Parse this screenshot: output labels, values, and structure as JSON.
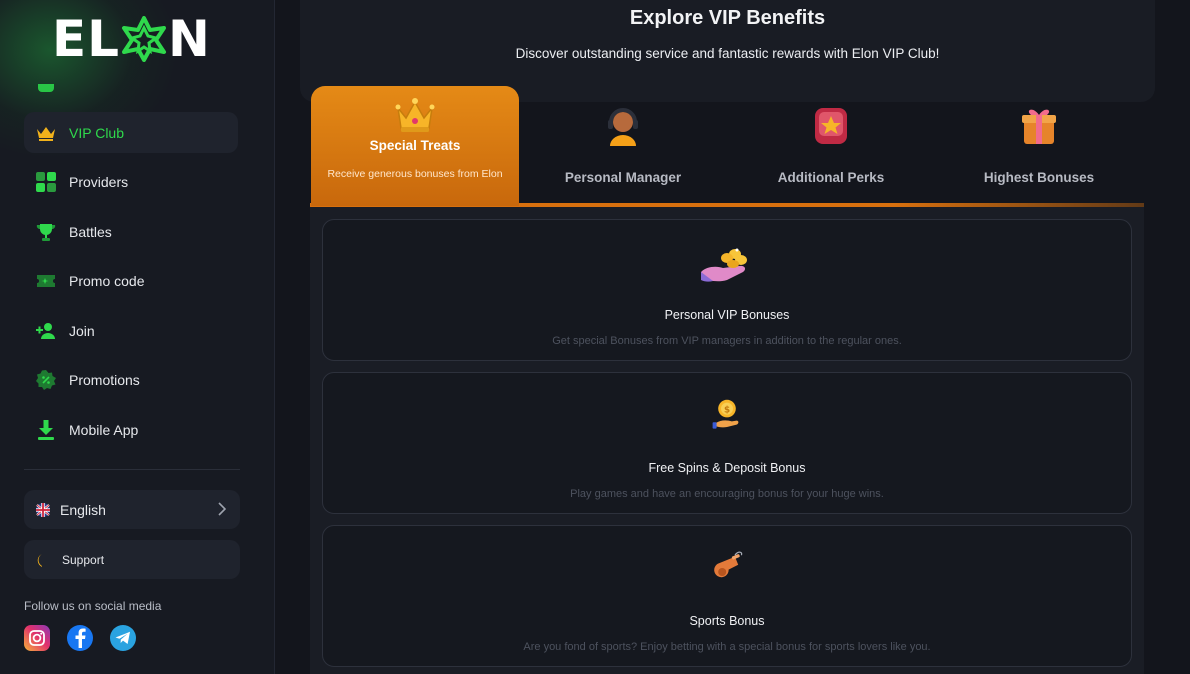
{
  "sidebar": {
    "logo": "ELON",
    "nav": [
      {
        "label": "VIP Club",
        "icon": "crown-icon",
        "active": true
      },
      {
        "label": "Providers",
        "icon": "grid-icon",
        "active": false
      },
      {
        "label": "Battles",
        "icon": "trophy-icon",
        "active": false
      },
      {
        "label": "Promo code",
        "icon": "ticket-icon",
        "active": false
      },
      {
        "label": "Join",
        "icon": "add-user-icon",
        "active": false
      },
      {
        "label": "Promotions",
        "icon": "badge-percent-icon",
        "active": false
      },
      {
        "label": "Mobile App",
        "icon": "download-icon",
        "active": false
      }
    ],
    "language": "English",
    "support": "Support",
    "follow": "Follow us on social media",
    "socials": [
      "instagram-icon",
      "facebook-icon",
      "telegram-icon"
    ]
  },
  "hero": {
    "title": "Explore VIP Benefits",
    "subtitle": "Discover outstanding service and fantastic rewards with Elon VIP Club!"
  },
  "tabs": [
    {
      "title": "Special Treats",
      "desc": "Receive generous bonuses from Elon",
      "icon": "crown-icon",
      "active": true
    },
    {
      "title": "Personal Manager",
      "desc": "",
      "icon": "headset-icon",
      "active": false
    },
    {
      "title": "Additional Perks",
      "desc": "",
      "icon": "star-badge-icon",
      "active": false
    },
    {
      "title": "Highest Bonuses",
      "desc": "",
      "icon": "gift-icon",
      "active": false
    }
  ],
  "cards": [
    {
      "title": "Personal VIP Bonuses",
      "desc": "Get special Bonuses from VIP managers in addition to the regular ones.",
      "icon": "hand-coins-icon"
    },
    {
      "title": "Free Spins & Deposit Bonus",
      "desc": "Play games and have an encouraging bonus for your huge wins.",
      "icon": "coin-hand-icon"
    },
    {
      "title": "Sports Bonus",
      "desc": "Are you fond of sports? Enjoy betting with a special bonus for sports lovers like you.",
      "icon": "whistle-icon"
    }
  ],
  "colors": {
    "accent": "#2fd94c",
    "orange": "#e58a16",
    "bg": "#13151c"
  }
}
